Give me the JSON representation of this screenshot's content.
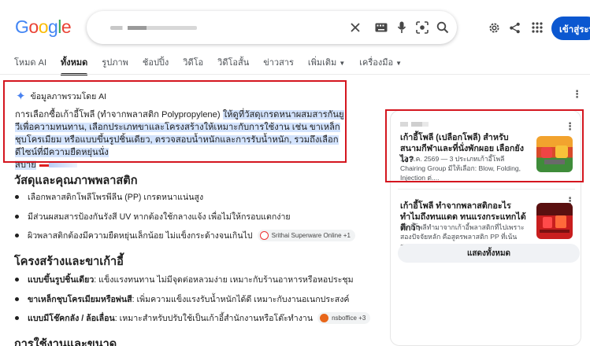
{
  "search": {
    "logo": "Google",
    "query_display": ""
  },
  "header": {
    "signin_label": "เข้าสู่ระบบ"
  },
  "tabs": [
    {
      "label": "โหมด AI"
    },
    {
      "label": "ทั้งหมด"
    },
    {
      "label": "รูปภาพ"
    },
    {
      "label": "ช้อปปิ้ง"
    },
    {
      "label": "วิดีโอ"
    },
    {
      "label": "วิดีโอสั้น"
    },
    {
      "label": "ข่าวสาร"
    },
    {
      "label": "เพิ่มเติม"
    },
    {
      "label": "เครื่องมือ"
    }
  ],
  "ai_overview": {
    "heading": "ข้อมูลภาพรวมโดย AI",
    "text_plain": "การเลือกซื้อเก้าอี้โพลี (ทำจากพลาสติก Polypropylene) ",
    "text_highlight_1": "ให้ดูที่วัสดุเกรดหนาผสมสารกันยูวีเพื่อความทนทาน, เลือกประเภทขาและโครงสร้างให้เหมาะกับการใช้งาน เช่น ขาเหล็กชุบโครเมียม หรือแบบขึ้นรูปชิ้นเดียว, ตรวจสอบน้ำหนักและการรับน้ำหนัก, รวมถึงเลือกดีไซน์ที่มีความยืดหยุ่นนั่ง",
    "text_highlight_2": "สบาย"
  },
  "section1": {
    "title": "วัสดุและคุณภาพพลาสติก",
    "bullets": [
      {
        "text": "เลือกพลาสติกโพลีโพรพีลีน (PP) เกรดหนาแน่นสูง"
      },
      {
        "text": "มีส่วนผสมสารป้องกันรังสี UV หากต้องใช้กลางแจ้ง เพื่อไม่ให้กรอบแตกง่าย"
      },
      {
        "text": "ผิวพลาสติกต้องมีความยืดหยุ่นเล็กน้อย ไม่แข็งกระด้างจนเกินไป",
        "chip": "Srithai Superware Online +1"
      }
    ]
  },
  "section2": {
    "title": "โครงสร้างและขาเก้าอี้",
    "bullets": [
      {
        "bold": "แบบขึ้นรูปชิ้นเดียว",
        "text": ": แข็งแรงทนทาน ไม่มีจุดต่อหลวมง่าย เหมาะกับร้านอาหารหรือหอประชุม"
      },
      {
        "bold": "ขาเหล็กชุบโครเมียมหรือพ่นสี",
        "text": ": เพิ่มความแข็งแรงรับน้ำหนักได้ดี เหมาะกับงานอเนกประสงค์"
      },
      {
        "bold": "แบบมีโช๊คกลัง / ล้อเลื่อน",
        "text": ": เหมาะสำหรับปรับใช้เป็นเก้าอี้สำนักงานหรือโต๊ะทำงาน",
        "chip": "nsboffice +3"
      }
    ]
  },
  "section3": {
    "title": "การใช้งานและขนาด"
  },
  "sources": {
    "cards": [
      {
        "title": "เก้าอี้โพลี (เปลือกโพลี) สำหรับสนามกีฬาและที่นั่งพักผอย เลือกยังไง?",
        "sub": "13 ส.ค. 2569 — 3 ประเภทเก้าอี้โพลี Chairing Group มีให้เลือก: Blow, Folding, Injection ต่...."
      },
      {
        "title": "เก้าอี้โพลี ทำจากพลาสติกอะไร ทำไมถึงทนแดด ทนแรงกระแทกได้ดีกว่า",
        "sub": "เก้าอี้โพลีทำมาจากเก้าอี้พลาสติกที่ไปเพราะสองปัจจัยหลัก คือสูตรพลาสติก PP ที่เน้นสาร..."
      }
    ],
    "show_all": "แสดงทั้งหมด"
  },
  "colors": {
    "brand_blue": "#0b57d0",
    "highlight": "#d3e3fd",
    "annotation_red": "#d4161f"
  }
}
